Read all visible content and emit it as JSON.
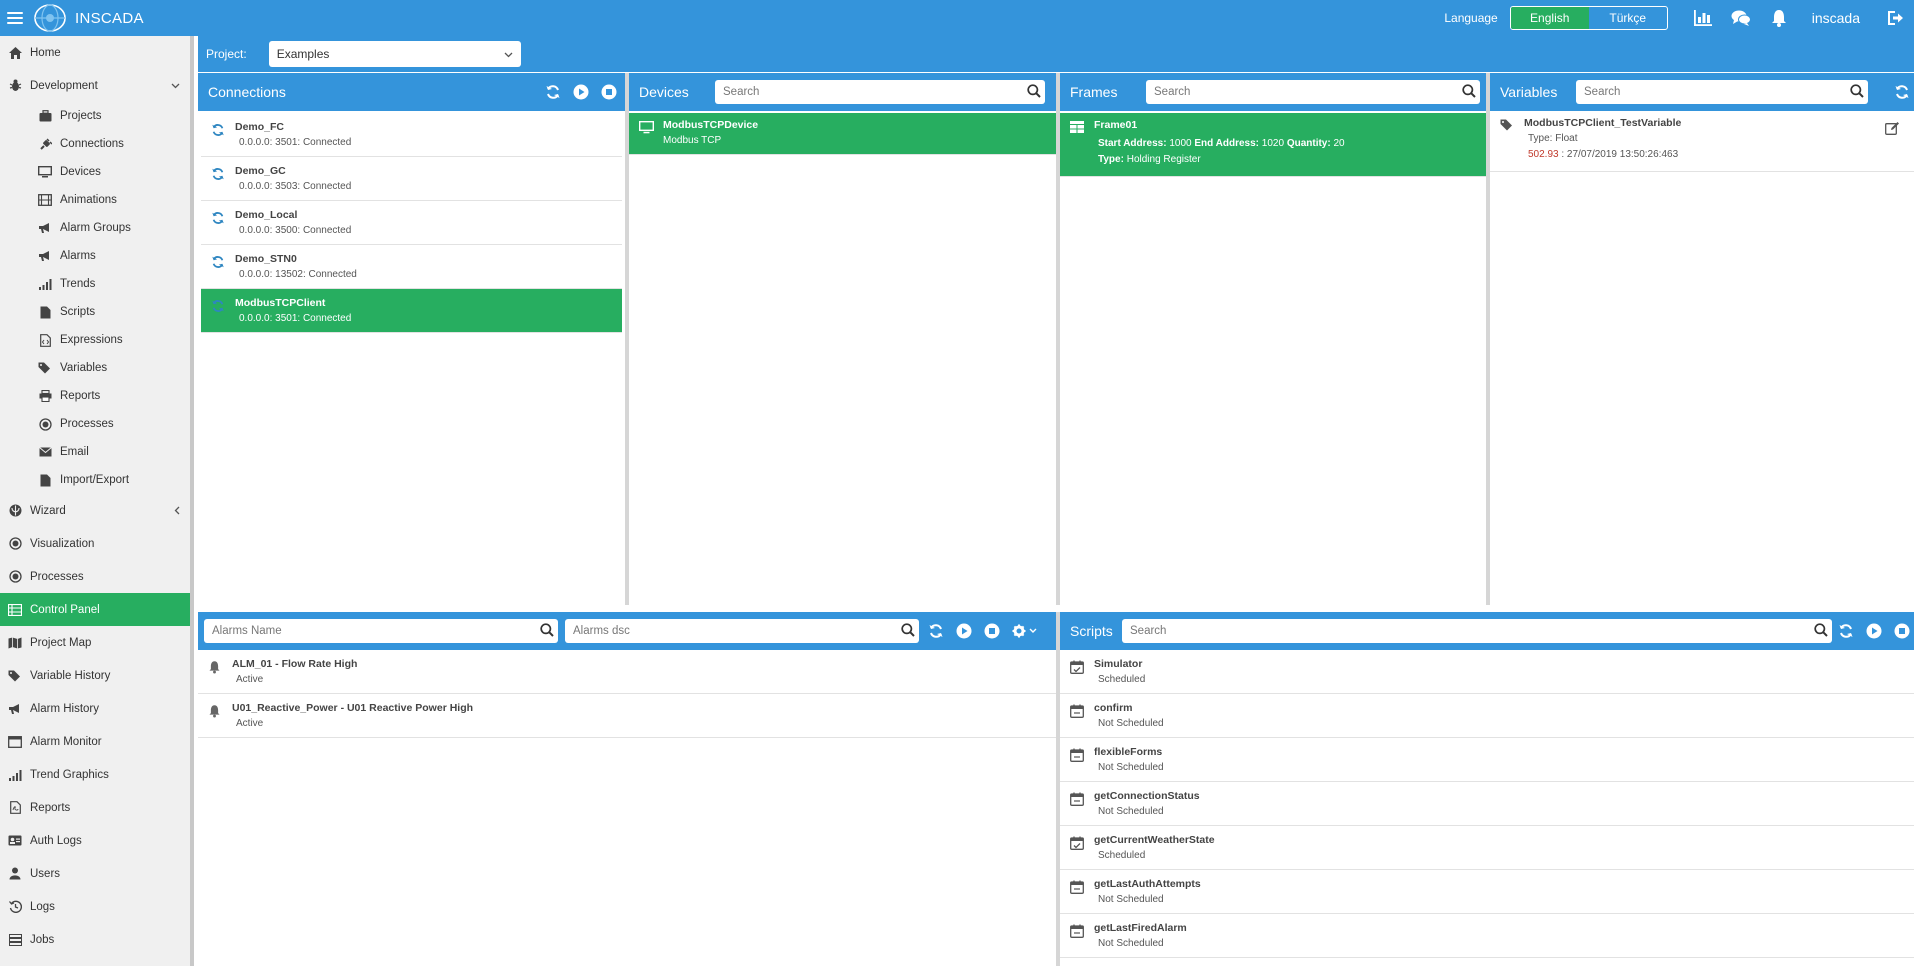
{
  "app": {
    "brand": "INSCADA",
    "username": "inscada"
  },
  "language": {
    "label": "Language",
    "options": [
      "English",
      "Türkçe"
    ],
    "selected": "English"
  },
  "sidebar": {
    "items": [
      {
        "label": "Home",
        "icon": "home-icon"
      },
      {
        "label": "Development",
        "icon": "bug-icon",
        "expanded": true
      },
      {
        "label": "Projects",
        "icon": "briefcase-icon",
        "sub": true
      },
      {
        "label": "Connections",
        "icon": "plug-icon",
        "sub": true
      },
      {
        "label": "Devices",
        "icon": "monitor-icon",
        "sub": true
      },
      {
        "label": "Animations",
        "icon": "film-icon",
        "sub": true
      },
      {
        "label": "Alarm Groups",
        "icon": "bullhorn-icon",
        "sub": true
      },
      {
        "label": "Alarms",
        "icon": "bullhorn-icon",
        "sub": true
      },
      {
        "label": "Trends",
        "icon": "signal-icon",
        "sub": true
      },
      {
        "label": "Scripts",
        "icon": "file-icon",
        "sub": true
      },
      {
        "label": "Expressions",
        "icon": "file-code-icon",
        "sub": true
      },
      {
        "label": "Variables",
        "icon": "tags-icon",
        "sub": true
      },
      {
        "label": "Reports",
        "icon": "print-icon",
        "sub": true
      },
      {
        "label": "Processes",
        "icon": "dot-circle-icon",
        "sub": true
      },
      {
        "label": "Email",
        "icon": "envelope-icon",
        "sub": true
      },
      {
        "label": "Import/Export",
        "icon": "file-icon",
        "sub": true
      },
      {
        "label": "Wizard",
        "icon": "rebel-icon",
        "collapsible": true
      },
      {
        "label": "Visualization",
        "icon": "dot-circle-icon"
      },
      {
        "label": "Processes",
        "icon": "dot-circle-icon"
      },
      {
        "label": "Control Panel",
        "icon": "list-icon",
        "active": true
      },
      {
        "label": "Project Map",
        "icon": "map-icon"
      },
      {
        "label": "Variable History",
        "icon": "tags-icon"
      },
      {
        "label": "Alarm History",
        "icon": "bullhorn-icon"
      },
      {
        "label": "Alarm Monitor",
        "icon": "window-icon"
      },
      {
        "label": "Trend Graphics",
        "icon": "signal-icon"
      },
      {
        "label": "Reports",
        "icon": "file-pdf-icon"
      },
      {
        "label": "Auth Logs",
        "icon": "id-card-icon"
      },
      {
        "label": "Users",
        "icon": "user-icon"
      },
      {
        "label": "Logs",
        "icon": "history-icon"
      },
      {
        "label": "Jobs",
        "icon": "tasks-icon"
      }
    ]
  },
  "project": {
    "label": "Project:",
    "selected": "Examples"
  },
  "connections": {
    "title": "Connections",
    "items": [
      {
        "name": "Demo_FC",
        "status": "0.0.0.0: 3501: Connected"
      },
      {
        "name": "Demo_GC",
        "status": "0.0.0.0: 3503: Connected"
      },
      {
        "name": "Demo_Local",
        "status": "0.0.0.0: 3500: Connected"
      },
      {
        "name": "Demo_STN0",
        "status": "0.0.0.0: 13502: Connected"
      },
      {
        "name": "ModbusTCPClient",
        "status": "0.0.0.0: 3501: Connected",
        "selected": true
      }
    ]
  },
  "devices": {
    "title": "Devices",
    "search_placeholder": "Search",
    "items": [
      {
        "name": "ModbusTCPDevice",
        "type": "Modbus TCP",
        "selected": true
      }
    ]
  },
  "frames": {
    "title": "Frames",
    "search_placeholder": "Search",
    "items": [
      {
        "name": "Frame01",
        "start_label": "Start Address:",
        "start": "1000",
        "end_label": "End Address:",
        "end": "1020",
        "qty_label": "Quantity:",
        "qty": "20",
        "type_label": "Type:",
        "type": "Holding Register"
      }
    ]
  },
  "variables": {
    "title": "Variables",
    "search_placeholder": "Search",
    "items": [
      {
        "name": "ModbusTCPClient_TestVariable",
        "type_label": "Type:",
        "type": "Float",
        "value": "502.93",
        "timestamp": " : 27/07/2019 13:50:26:463"
      }
    ]
  },
  "alarms": {
    "name_placeholder": "Alarms Name",
    "dsc_placeholder": "Alarms dsc",
    "items": [
      {
        "name": "ALM_01 - Flow Rate High",
        "status": "Active"
      },
      {
        "name": "U01_Reactive_Power - U01 Reactive Power High",
        "status": "Active"
      }
    ]
  },
  "scripts": {
    "title": "Scripts",
    "search_placeholder": "Search",
    "items": [
      {
        "name": "Simulator",
        "status": "Scheduled"
      },
      {
        "name": "confirm",
        "status": "Not Scheduled"
      },
      {
        "name": "flexibleForms",
        "status": "Not Scheduled"
      },
      {
        "name": "getConnectionStatus",
        "status": "Not Scheduled"
      },
      {
        "name": "getCurrentWeatherState",
        "status": "Scheduled"
      },
      {
        "name": "getLastAuthAttempts",
        "status": "Not Scheduled"
      },
      {
        "name": "getLastFiredAlarm",
        "status": "Not Scheduled"
      }
    ]
  },
  "colors": {
    "primary": "#3494db",
    "active": "#27ae60",
    "value_red": "#c0392b"
  }
}
